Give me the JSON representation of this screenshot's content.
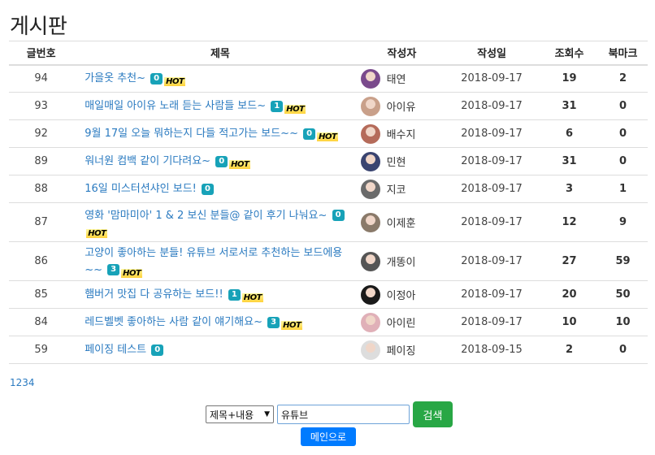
{
  "page_title": "게시판",
  "columns": {
    "no": "글번호",
    "title": "제목",
    "author": "작성자",
    "date": "작성일",
    "views": "조회수",
    "bookmarks": "북마크"
  },
  "hot_label": "HOT",
  "rows": [
    {
      "no": "94",
      "title": "가을옷 추천~",
      "comments": "0",
      "hot": true,
      "author": "태연",
      "date": "2018-09-17",
      "views": "19",
      "bookmarks": "2"
    },
    {
      "no": "93",
      "title": "매일매일 아이유 노래 듣는 사람들 보드~",
      "comments": "1",
      "hot": true,
      "author": "아이유",
      "date": "2018-09-17",
      "views": "31",
      "bookmarks": "0"
    },
    {
      "no": "92",
      "title": "9월 17일 오늘 뭐하는지 다들 적고가는 보드~~",
      "comments": "0",
      "hot": true,
      "author": "배수지",
      "date": "2018-09-17",
      "views": "6",
      "bookmarks": "0"
    },
    {
      "no": "89",
      "title": "워너원 컴백 같이 기다려요~",
      "comments": "0",
      "hot": true,
      "author": "민현",
      "date": "2018-09-17",
      "views": "31",
      "bookmarks": "0"
    },
    {
      "no": "88",
      "title": "16일 미스터션샤인 보드!",
      "comments": "0",
      "hot": false,
      "author": "지코",
      "date": "2018-09-17",
      "views": "3",
      "bookmarks": "1"
    },
    {
      "no": "87",
      "title": "영화 '맘마미아' 1 & 2 보신 분들@ 같이 후기 나눠요~",
      "comments": "0",
      "hot": true,
      "author": "이제훈",
      "date": "2018-09-17",
      "views": "12",
      "bookmarks": "9"
    },
    {
      "no": "86",
      "title": "고양이 좋아하는 분들! 유튜브 서로서로 추천하는 보드에용~~",
      "comments": "3",
      "hot": true,
      "author": "개똥이",
      "date": "2018-09-17",
      "views": "27",
      "bookmarks": "59"
    },
    {
      "no": "85",
      "title": "햄버거 맛집 다 공유하는 보드!!",
      "comments": "1",
      "hot": true,
      "author": "이정아",
      "date": "2018-09-17",
      "views": "20",
      "bookmarks": "50"
    },
    {
      "no": "84",
      "title": "레드벨벳 좋아하는 사람 같이 얘기해요~",
      "comments": "3",
      "hot": true,
      "author": "아이린",
      "date": "2018-09-17",
      "views": "10",
      "bookmarks": "10"
    },
    {
      "no": "59",
      "title": "페이징 테스트",
      "comments": "0",
      "hot": false,
      "author": "페이징",
      "date": "2018-09-15",
      "views": "2",
      "bookmarks": "0"
    }
  ],
  "pagination": [
    "1",
    "2",
    "3",
    "4"
  ],
  "search": {
    "selected_option": "제목+내용",
    "query": "유튜브",
    "button_label": "검색"
  },
  "main_button_label": "메인으로",
  "colors": {
    "link": "#2a7ac0",
    "badge": "#17a2b8",
    "search_button": "#28a745",
    "main_button": "#007bff"
  }
}
